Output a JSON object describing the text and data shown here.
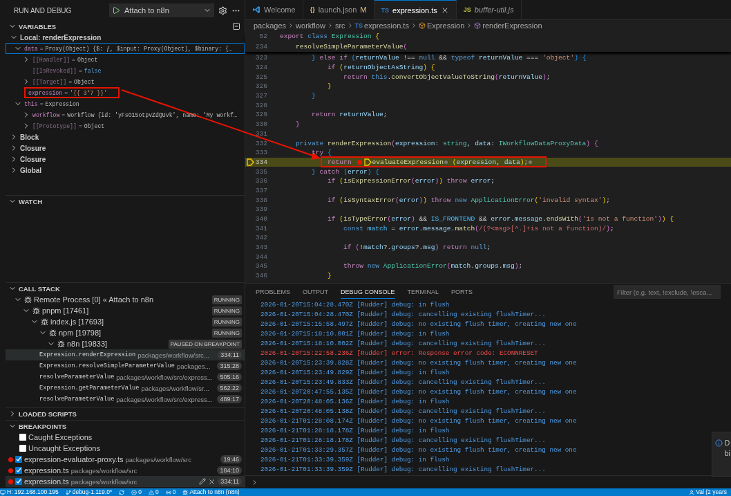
{
  "sidebar": {
    "title": "RUN AND DEBUG",
    "launch_config": "Attach to n8n",
    "variables": {
      "title": "VARIABLES",
      "expanded": true,
      "scopes": [
        {
          "name": "Local: renderExpression",
          "expanded": true,
          "items": [
            {
              "name": "data",
              "sep": "=",
              "value": "Proxy(Object) {$: ƒ, $input: Proxy(Object), $binary: {…",
              "kind": "object",
              "expanded": true,
              "selected": true,
              "annotated": false,
              "internal": false,
              "children": [
                {
                  "name": "[[Handler]]",
                  "sep": "=",
                  "value": "Object",
                  "kind": "object",
                  "expanded": false,
                  "selected": false,
                  "annotated": false,
                  "internal": true
                },
                {
                  "name": "[[IsRevoked]]",
                  "sep": "=",
                  "value": "false",
                  "kind": "bool",
                  "selected": false,
                  "annotated": false,
                  "internal": true
                },
                {
                  "name": "[[Target]]",
                  "sep": "=",
                  "value": "Object",
                  "kind": "object",
                  "expanded": false,
                  "selected": false,
                  "annotated": false,
                  "internal": true
                }
              ]
            },
            {
              "name": "expression",
              "sep": "=",
              "value": "'{{ 3*7 }}'",
              "kind": "string",
              "selected": false,
              "annotated": true,
              "internal": false
            },
            {
              "name": "this",
              "sep": "=",
              "value": "Expression",
              "kind": "object",
              "expanded": true,
              "selected": false,
              "annotated": false,
              "internal": false,
              "children": [
                {
                  "name": "workflow",
                  "sep": "=",
                  "value": "Workflow {id: 'yFsO15otpvZdQUvk', name: 'My workf…",
                  "kind": "object",
                  "expanded": false,
                  "selected": false,
                  "annotated": false,
                  "internal": false
                },
                {
                  "name": "[[Prototype]]",
                  "sep": "=",
                  "value": "Object",
                  "kind": "object",
                  "expanded": false,
                  "selected": false,
                  "annotated": false,
                  "internal": true
                }
              ]
            }
          ]
        },
        {
          "name": "Block",
          "expanded": false
        },
        {
          "name": "Closure",
          "expanded": false
        },
        {
          "name": "Closure",
          "expanded": false
        },
        {
          "name": "Global",
          "expanded": false
        }
      ]
    },
    "watch": {
      "title": "WATCH",
      "expanded": true
    },
    "call_stack": {
      "title": "CALL STACK",
      "expanded": true,
      "threads": [
        {
          "name": "Remote Process [0] « Attach to n8n",
          "status": "RUNNING",
          "expanded": true,
          "children": [
            {
              "name": "pnpm [17461]",
              "status": "RUNNING",
              "expanded": true,
              "children": [
                {
                  "name": "index.js [17693]",
                  "status": "RUNNING",
                  "expanded": true,
                  "children": [
                    {
                      "name": "npm [19798]",
                      "status": "RUNNING",
                      "expanded": true,
                      "children": [
                        {
                          "name": "n8n [19833]",
                          "status": "PAUSED ON BREAKPOINT",
                          "expanded": true,
                          "frames": [
                            {
                              "function": "Expression.renderExpression",
                              "path": "packages/workflow/src...",
                              "position": "334:11",
                              "selected": true
                            },
                            {
                              "function": "Expression.resolveSimpleParameterValue",
                              "path": "packages...",
                              "position": "315:28",
                              "selected": false
                            },
                            {
                              "function": "resolveParameterValue",
                              "path": "packages/workflow/src/express...",
                              "position": "505:16",
                              "selected": false
                            },
                            {
                              "function": "Expression.getParameterValue",
                              "path": "packages/workflow/sr...",
                              "position": "562:22",
                              "selected": false
                            },
                            {
                              "function": "resolveParameterValue",
                              "path": "packages/workflow/src/express...",
                              "position": "489:17",
                              "selected": false
                            }
                          ]
                        }
                      ]
                    }
                  ]
                }
              ]
            }
          ]
        }
      ]
    },
    "loaded_scripts": {
      "title": "LOADED SCRIPTS",
      "expanded": false
    },
    "breakpoints": {
      "title": "BREAKPOINTS",
      "expanded": true,
      "items": [
        {
          "kind": "exception",
          "label": "Caught Exceptions",
          "checked": false,
          "selected": false
        },
        {
          "kind": "exception",
          "label": "Uncaught Exceptions",
          "checked": false,
          "selected": false
        },
        {
          "kind": "file",
          "label": "expression-evaluator-proxy.ts",
          "path": "packages/workflow/src",
          "position": "19:46",
          "checked": true,
          "selected": false
        },
        {
          "kind": "file",
          "label": "expression.ts",
          "path": "packages/workflow/src",
          "position": "184:10",
          "checked": true,
          "selected": false
        },
        {
          "kind": "file",
          "label": "expression.ts",
          "path": "packages/workflow/src",
          "position": "334:11",
          "checked": true,
          "selected": true
        }
      ]
    }
  },
  "editor": {
    "tabs": [
      {
        "kind": "logo",
        "label": "Welcome",
        "selected": false,
        "preview": false
      },
      {
        "kind": "json",
        "icon_text": "{}",
        "label": "launch.json",
        "status": "M",
        "selected": false,
        "preview": false
      },
      {
        "kind": "ts",
        "icon_text": "TS",
        "label": "expression.ts",
        "selected": true,
        "preview": false
      },
      {
        "kind": "js",
        "icon_text": "JS",
        "label": "buffer-util.js",
        "selected": false,
        "preview": true
      }
    ],
    "breadcrumbs": [
      {
        "kind": "folder",
        "label": "packages"
      },
      {
        "kind": "folder",
        "label": "workflow"
      },
      {
        "kind": "folder",
        "label": "src"
      },
      {
        "kind": "ts",
        "icon_text": "TS",
        "label": "expression.ts"
      },
      {
        "kind": "class",
        "label": "Expression"
      },
      {
        "kind": "method",
        "label": "renderExpression"
      }
    ],
    "sticky_lines": [
      {
        "num": "52",
        "tokens": [
          {
            "text": "export ",
            "kind": "control"
          },
          {
            "text": "class ",
            "kind": "keyword"
          },
          {
            "text": "Expression ",
            "kind": "type"
          },
          {
            "text": "{",
            "kind": "bracket1"
          }
        ]
      },
      {
        "num": "234",
        "tokens": [
          {
            "text": "    resolveSimpleParameterValue",
            "kind": "function"
          },
          {
            "text": "(",
            "kind": "bracket2"
          }
        ]
      }
    ],
    "lines": [
      {
        "num": "323",
        "tokens": [
          {
            "text": "        }",
            "kind": "bracket3"
          },
          {
            "text": " else if ",
            "kind": "control"
          },
          {
            "text": "(",
            "kind": "bracket3"
          },
          {
            "text": "returnValue",
            "kind": "variable"
          },
          {
            "text": " !== ",
            "kind": "plain"
          },
          {
            "text": "null",
            "kind": "keyword"
          },
          {
            "text": " && ",
            "kind": "plain"
          },
          {
            "text": "typeof ",
            "kind": "keyword"
          },
          {
            "text": "returnValue",
            "kind": "variable"
          },
          {
            "text": " === ",
            "kind": "plain"
          },
          {
            "text": "'object'",
            "kind": "string"
          },
          {
            "text": ")",
            "kind": "bracket3"
          },
          {
            "text": " {",
            "kind": "bracket3"
          }
        ]
      },
      {
        "num": "324",
        "tokens": [
          {
            "text": "            if ",
            "kind": "control"
          },
          {
            "text": "(",
            "kind": "bracket1"
          },
          {
            "text": "returnObjectAsString",
            "kind": "variable"
          },
          {
            "text": ")",
            "kind": "bracket1"
          },
          {
            "text": " {",
            "kind": "bracket1"
          }
        ]
      },
      {
        "num": "325",
        "tokens": [
          {
            "text": "                return ",
            "kind": "control"
          },
          {
            "text": "this",
            "kind": "keyword"
          },
          {
            "text": ".",
            "kind": "plain"
          },
          {
            "text": "convertObjectValueToString",
            "kind": "function"
          },
          {
            "text": "(",
            "kind": "bracket2"
          },
          {
            "text": "returnValue",
            "kind": "variable"
          },
          {
            "text": ")",
            "kind": "bracket2"
          },
          {
            "text": ";",
            "kind": "plain"
          }
        ]
      },
      {
        "num": "326",
        "tokens": [
          {
            "text": "            }",
            "kind": "bracket1"
          }
        ]
      },
      {
        "num": "327",
        "tokens": [
          {
            "text": "        }",
            "kind": "bracket3"
          }
        ]
      },
      {
        "num": "328"
      },
      {
        "num": "329",
        "tokens": [
          {
            "text": "        return ",
            "kind": "control"
          },
          {
            "text": "returnValue",
            "kind": "variable"
          },
          {
            "text": ";",
            "kind": "plain"
          }
        ]
      },
      {
        "num": "330",
        "tokens": [
          {
            "text": "    }",
            "kind": "bracket2"
          }
        ]
      },
      {
        "num": "331"
      },
      {
        "num": "332",
        "tokens": [
          {
            "text": "    private ",
            "kind": "keyword"
          },
          {
            "text": "renderExpression",
            "kind": "function"
          },
          {
            "text": "(",
            "kind": "bracket2"
          },
          {
            "text": "expression",
            "kind": "variable"
          },
          {
            "text": ": ",
            "kind": "plain"
          },
          {
            "text": "string",
            "kind": "type"
          },
          {
            "text": ", ",
            "kind": "plain"
          },
          {
            "text": "data",
            "kind": "variable"
          },
          {
            "text": ": ",
            "kind": "plain"
          },
          {
            "text": "IWorkflowDataProxyData",
            "kind": "type"
          },
          {
            "text": ")",
            "kind": "bracket2"
          },
          {
            "text": " {",
            "kind": "bracket2"
          }
        ]
      },
      {
        "num": "333",
        "tokens": [
          {
            "text": "        try ",
            "kind": "control"
          },
          {
            "text": "{",
            "kind": "bracket3"
          }
        ]
      },
      {
        "num": "334",
        "current": true,
        "breakpoint": true,
        "annotated": true,
        "tokens": [
          {
            "text": "            return ",
            "kind": "control"
          },
          {
            "kind": "breakpoint"
          },
          {
            "kind": "current"
          },
          {
            "text": "evaluateExpression",
            "kind": "function"
          },
          {
            "kind": "dot"
          },
          {
            "text": " (",
            "kind": "bracket1"
          },
          {
            "text": "expression",
            "kind": "variable"
          },
          {
            "text": ", ",
            "kind": "plain"
          },
          {
            "text": "data",
            "kind": "variable"
          },
          {
            "text": ")",
            "kind": "bracket1"
          },
          {
            "text": ";",
            "kind": "plain"
          },
          {
            "kind": "dot"
          }
        ]
      },
      {
        "num": "335",
        "tokens": [
          {
            "text": "        }",
            "kind": "bracket3"
          },
          {
            "text": " catch ",
            "kind": "control"
          },
          {
            "text": "(",
            "kind": "bracket3"
          },
          {
            "text": "error",
            "kind": "variable"
          },
          {
            "text": ")",
            "kind": "bracket3"
          },
          {
            "text": " {",
            "kind": "bracket3"
          }
        ]
      },
      {
        "num": "336",
        "tokens": [
          {
            "text": "            if ",
            "kind": "control"
          },
          {
            "text": "(",
            "kind": "bracket1"
          },
          {
            "text": "isExpressionError",
            "kind": "function"
          },
          {
            "text": "(",
            "kind": "bracket2"
          },
          {
            "text": "error",
            "kind": "variable"
          },
          {
            "text": ")",
            "kind": "bracket2"
          },
          {
            "text": ")",
            "kind": "bracket1"
          },
          {
            "text": " throw ",
            "kind": "control"
          },
          {
            "text": "error",
            "kind": "variable"
          },
          {
            "text": ";",
            "kind": "plain"
          }
        ]
      },
      {
        "num": "337"
      },
      {
        "num": "338",
        "tokens": [
          {
            "text": "            if ",
            "kind": "control"
          },
          {
            "text": "(",
            "kind": "bracket1"
          },
          {
            "text": "isSyntaxError",
            "kind": "function"
          },
          {
            "text": "(",
            "kind": "bracket2"
          },
          {
            "text": "error",
            "kind": "variable"
          },
          {
            "text": ")",
            "kind": "bracket2"
          },
          {
            "text": ")",
            "kind": "bracket1"
          },
          {
            "text": " throw ",
            "kind": "control"
          },
          {
            "text": "new ",
            "kind": "keyword"
          },
          {
            "text": "ApplicationError",
            "kind": "type"
          },
          {
            "text": "(",
            "kind": "bracket1"
          },
          {
            "text": "'invalid syntax'",
            "kind": "string"
          },
          {
            "text": ")",
            "kind": "bracket1"
          },
          {
            "text": ";",
            "kind": "plain"
          }
        ]
      },
      {
        "num": "339"
      },
      {
        "num": "340",
        "tokens": [
          {
            "text": "            if ",
            "kind": "control"
          },
          {
            "text": "(",
            "kind": "bracket1"
          },
          {
            "text": "isTypeError",
            "kind": "function"
          },
          {
            "text": "(",
            "kind": "bracket2"
          },
          {
            "text": "error",
            "kind": "variable"
          },
          {
            "text": ")",
            "kind": "bracket2"
          },
          {
            "text": " && ",
            "kind": "plain"
          },
          {
            "text": "IS_FRONTEND",
            "kind": "constant"
          },
          {
            "text": " && ",
            "kind": "plain"
          },
          {
            "text": "error",
            "kind": "variable"
          },
          {
            "text": ".",
            "kind": "plain"
          },
          {
            "text": "message",
            "kind": "variable"
          },
          {
            "text": ".",
            "kind": "plain"
          },
          {
            "text": "endsWith",
            "kind": "function"
          },
          {
            "text": "(",
            "kind": "bracket2"
          },
          {
            "text": "'is not a function'",
            "kind": "string"
          },
          {
            "text": ")",
            "kind": "bracket2"
          },
          {
            "text": ")",
            "kind": "bracket1"
          },
          {
            "text": " {",
            "kind": "bracket1"
          }
        ]
      },
      {
        "num": "341",
        "tokens": [
          {
            "text": "                const ",
            "kind": "keyword"
          },
          {
            "text": "match",
            "kind": "constant"
          },
          {
            "text": " = ",
            "kind": "plain"
          },
          {
            "text": "error",
            "kind": "variable"
          },
          {
            "text": ".",
            "kind": "plain"
          },
          {
            "text": "message",
            "kind": "variable"
          },
          {
            "text": ".",
            "kind": "plain"
          },
          {
            "text": "match",
            "kind": "function"
          },
          {
            "text": "(",
            "kind": "bracket2"
          },
          {
            "text": "/(?<msg>[^.]+is not a function)/",
            "kind": "regex"
          },
          {
            "text": ")",
            "kind": "bracket2"
          },
          {
            "text": ";",
            "kind": "plain"
          }
        ]
      },
      {
        "num": "342"
      },
      {
        "num": "343",
        "tokens": [
          {
            "text": "                if ",
            "kind": "control"
          },
          {
            "text": "(",
            "kind": "bracket2"
          },
          {
            "text": "!",
            "kind": "plain"
          },
          {
            "text": "match",
            "kind": "variable"
          },
          {
            "text": "?.",
            "kind": "plain"
          },
          {
            "text": "groups",
            "kind": "variable"
          },
          {
            "text": "?.",
            "kind": "plain"
          },
          {
            "text": "msg",
            "kind": "variable"
          },
          {
            "text": ")",
            "kind": "bracket2"
          },
          {
            "text": " return ",
            "kind": "control"
          },
          {
            "text": "null",
            "kind": "keyword"
          },
          {
            "text": ";",
            "kind": "plain"
          }
        ]
      },
      {
        "num": "344"
      },
      {
        "num": "345",
        "tokens": [
          {
            "text": "                throw ",
            "kind": "control"
          },
          {
            "text": "new ",
            "kind": "keyword"
          },
          {
            "text": "ApplicationError",
            "kind": "type"
          },
          {
            "text": "(",
            "kind": "bracket2"
          },
          {
            "text": "match",
            "kind": "variable"
          },
          {
            "text": ".",
            "kind": "plain"
          },
          {
            "text": "groups",
            "kind": "variable"
          },
          {
            "text": ".",
            "kind": "plain"
          },
          {
            "text": "msg",
            "kind": "variable"
          },
          {
            "text": ")",
            "kind": "bracket2"
          },
          {
            "text": ";",
            "kind": "plain"
          }
        ]
      },
      {
        "num": "346",
        "tokens": [
          {
            "text": "            }",
            "kind": "bracket1"
          }
        ]
      }
    ]
  },
  "panel": {
    "tabs": [
      {
        "label": "PROBLEMS",
        "selected": false
      },
      {
        "label": "OUTPUT",
        "selected": false
      },
      {
        "label": "DEBUG CONSOLE",
        "selected": true
      },
      {
        "label": "TERMINAL",
        "selected": false
      },
      {
        "label": "PORTS",
        "selected": false
      }
    ],
    "filter": {
      "placeholder": "Filter (e.g. text, !exclude, \\esca..."
    },
    "console": [
      {
        "kind": "debug",
        "text": "2026-01-20T15:04:28.470Z [Rudder] debug: in flush"
      },
      {
        "kind": "debug",
        "text": "2026-01-20T15:04:28.470Z [Rudder] debug: cancelling existing flushTimer..."
      },
      {
        "kind": "debug",
        "text": "2026-01-20T15:15:58.497Z [Rudder] debug: no existing flush timer, creating new one"
      },
      {
        "kind": "debug",
        "text": "2026-01-20T15:18:10.001Z [Rudder] debug: in flush"
      },
      {
        "kind": "debug",
        "text": "2026-01-20T15:18:10.002Z [Rudder] debug: cancelling existing flushTimer..."
      },
      {
        "kind": "error",
        "text": "2026-01-20T15:22:58.236Z [Rudder] error: Response error code: ECONNRESET"
      },
      {
        "kind": "debug",
        "text": "2026-01-20T15:23:39.828Z [Rudder] debug: no existing flush timer, creating new one"
      },
      {
        "kind": "debug",
        "text": "2026-01-20T15:23:49.829Z [Rudder] debug: in flush"
      },
      {
        "kind": "debug",
        "text": "2026-01-20T15:23:49.833Z [Rudder] debug: cancelling existing flushTimer..."
      },
      {
        "kind": "debug",
        "text": "2026-01-20T20:47:55.135Z [Rudder] debug: no existing flush timer, creating new one"
      },
      {
        "kind": "debug",
        "text": "2026-01-20T20:48:05.136Z [Rudder] debug: in flush"
      },
      {
        "kind": "debug",
        "text": "2026-01-20T20:48:05.138Z [Rudder] debug: cancelling existing flushTimer..."
      },
      {
        "kind": "debug",
        "text": "2026-01-21T01:28:08.174Z [Rudder] debug: no existing flush timer, creating new one"
      },
      {
        "kind": "debug",
        "text": "2026-01-21T01:28:18.178Z [Rudder] debug: in flush"
      },
      {
        "kind": "debug",
        "text": "2026-01-21T01:28:18.178Z [Rudder] debug: cancelling existing flushTimer..."
      },
      {
        "kind": "debug",
        "text": "2026-01-21T01:33:29.357Z [Rudder] debug: no existing flush timer, creating new one"
      },
      {
        "kind": "debug",
        "text": "2026-01-21T01:33:39.359Z [Rudder] debug: in flush"
      },
      {
        "kind": "debug",
        "text": "2026-01-21T01:33:39.359Z [Rudder] debug: cancelling existing flushTimer..."
      }
    ],
    "notification": {
      "lines": [
        "D",
        "bi"
      ]
    }
  },
  "status_bar": {
    "left": [
      {
        "kind": "remote",
        "text": "H: 192.168.100.195"
      },
      {
        "kind": "branch",
        "text": "debug-1.119.0*"
      },
      {
        "kind": "sync"
      },
      {
        "kind": "error",
        "text": "0"
      },
      {
        "kind": "warning",
        "text": "0"
      },
      {
        "kind": "ports",
        "text": "0"
      },
      {
        "kind": "debug",
        "text": "Attach to n8n (n8n)"
      }
    ],
    "right": [
      {
        "kind": "person",
        "text": "Val (2 years"
      }
    ]
  }
}
